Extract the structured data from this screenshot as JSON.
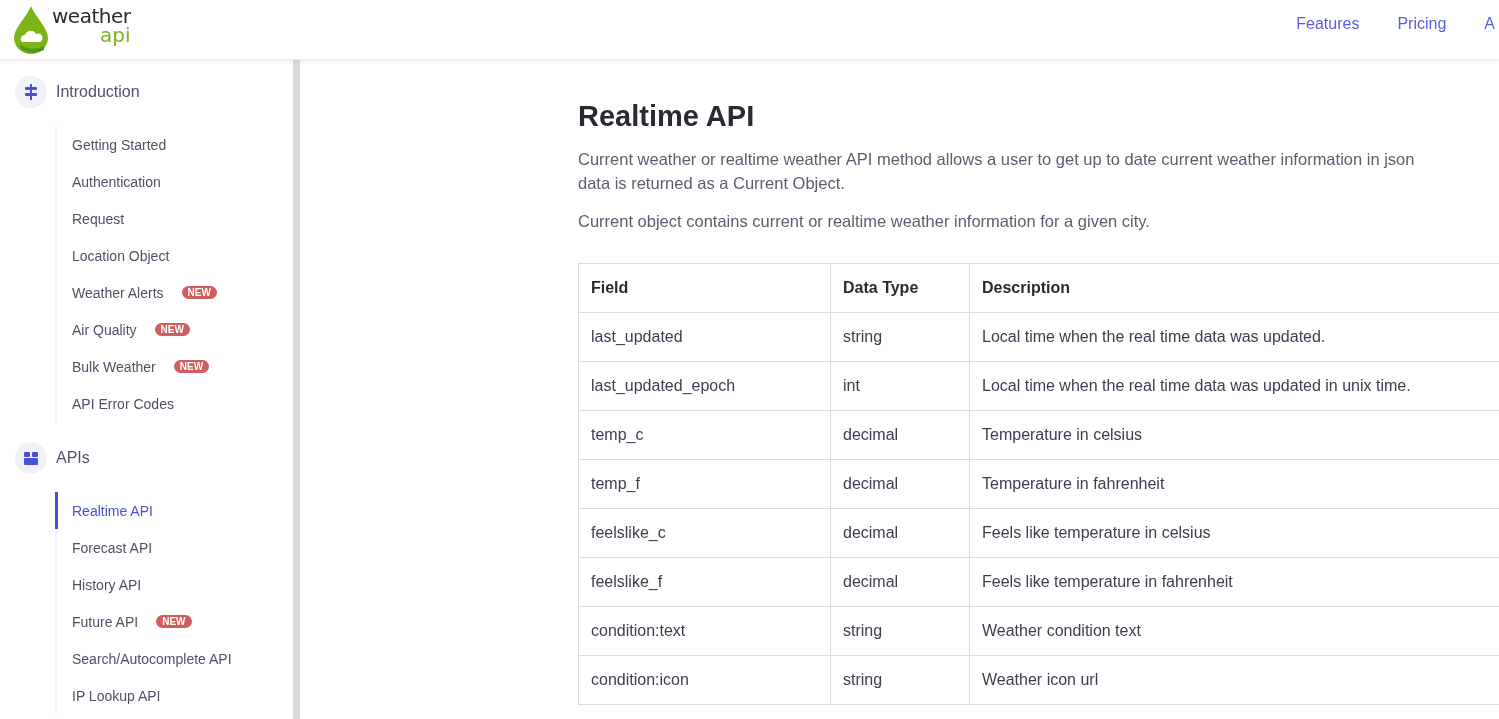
{
  "header": {
    "logo": {
      "word": "weather",
      "sub": "api"
    },
    "nav": [
      {
        "label": "Features"
      },
      {
        "label": "Pricing"
      },
      {
        "label": "A"
      }
    ]
  },
  "sidebar": {
    "sections": [
      {
        "title": "Introduction",
        "kind": "signpost",
        "items": [
          {
            "label": "Getting Started",
            "selected": false
          },
          {
            "label": "Authentication",
            "selected": false
          },
          {
            "label": "Request",
            "selected": false
          },
          {
            "label": "Location Object",
            "selected": false
          },
          {
            "label": "Weather Alerts",
            "selected": false,
            "badge": "NEW"
          },
          {
            "label": "Air Quality",
            "selected": false,
            "badge": "NEW"
          },
          {
            "label": "Bulk Weather",
            "selected": false,
            "badge": "NEW"
          },
          {
            "label": "API Error Codes",
            "selected": false
          }
        ]
      },
      {
        "title": "APIs",
        "kind": "box",
        "items": [
          {
            "label": "Realtime API",
            "selected": true
          },
          {
            "label": "Forecast API",
            "selected": false
          },
          {
            "label": "History API",
            "selected": false
          },
          {
            "label": "Future API",
            "selected": false,
            "badge": "NEW"
          },
          {
            "label": "Search/Autocomplete API",
            "selected": false
          },
          {
            "label": "IP Lookup API",
            "selected": false
          }
        ]
      }
    ]
  },
  "content": {
    "title": "Realtime API",
    "paragraphs": [
      [
        "Current weather or realtime weather API method allows a user to get up to date current weather information in json",
        "data is returned as a Current Object."
      ],
      [
        "Current object contains current or realtime weather information for a given city."
      ]
    ],
    "table": {
      "columns": [
        "Field",
        "Data Type",
        "Description"
      ],
      "rows": [
        [
          "last_updated",
          "string",
          "Local time when the real time data was updated."
        ],
        [
          "last_updated_epoch",
          "int",
          "Local time when the real time data was updated in unix time."
        ],
        [
          "temp_c",
          "decimal",
          "Temperature in celsius"
        ],
        [
          "temp_f",
          "decimal",
          "Temperature in fahrenheit"
        ],
        [
          "feelslike_c",
          "decimal",
          "Feels like temperature in celsius"
        ],
        [
          "feelslike_f",
          "decimal",
          "Feels like temperature in fahrenheit"
        ],
        [
          "condition:text",
          "string",
          "Weather condition text"
        ],
        [
          "condition:icon",
          "string",
          "Weather icon url"
        ]
      ]
    }
  }
}
